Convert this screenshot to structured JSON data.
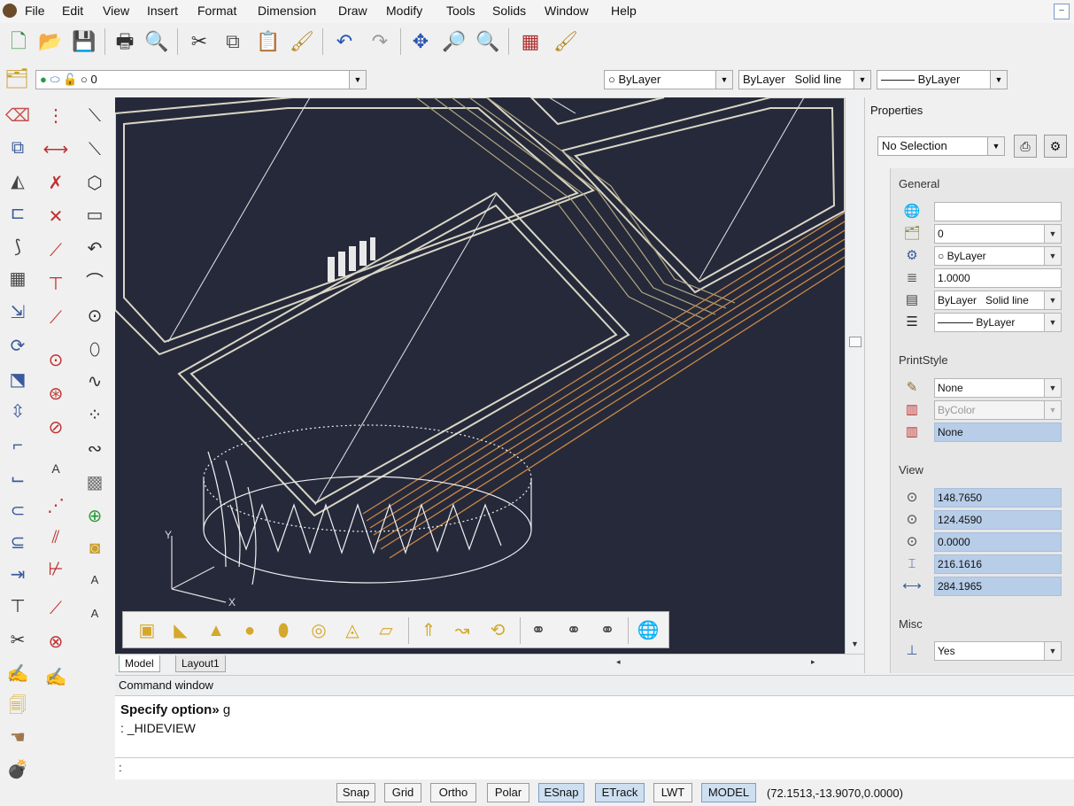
{
  "menu": [
    "File",
    "Edit",
    "View",
    "Insert",
    "Format",
    "Dimension",
    "Draw",
    "Modify",
    "Tools",
    "Solids",
    "Window",
    "Help"
  ],
  "layer_bar": {
    "layer_value": "0",
    "color_value": "ByLayer",
    "linetype_value": "ByLayer",
    "linetype_name": "Solid line",
    "lineweight_value": "ByLayer"
  },
  "viewport": {
    "tabs": [
      "Model",
      "Layout1"
    ],
    "ucs_labels": {
      "x": "X",
      "y": "Y"
    }
  },
  "properties": {
    "title": "Properties",
    "selection": "No Selection",
    "sections": {
      "general": "General",
      "printstyle": "PrintStyle",
      "view": "View",
      "misc": "Misc"
    },
    "general": {
      "color": "",
      "layer": "0",
      "linetype_label": "ByLayer",
      "scale": "1.0000",
      "lineweight_bylayer": "ByLayer",
      "lineweight_name": "Solid line",
      "thickness": "ByLayer"
    },
    "printstyle": {
      "style": "None",
      "color": "ByColor",
      "table": "None"
    },
    "view": [
      "148.7650",
      "124.4590",
      "0.0000",
      "216.1616",
      "284.1965"
    ],
    "misc": {
      "value": "Yes"
    }
  },
  "command": {
    "title": "Command window",
    "line1_bold": "Specify option»",
    "line1_value": " g",
    "line2": ": _HIDEVIEW",
    "prompt": ":"
  },
  "status": {
    "buttons": [
      "Snap",
      "Grid",
      "Ortho",
      "Polar",
      "ESnap",
      "ETrack",
      "LWT",
      "MODEL"
    ],
    "active": [
      "ESnap",
      "ETrack",
      "MODEL"
    ],
    "coordinates": "(72.1513,-13.9070,0.0000)"
  },
  "colors": {
    "viewport_bg": "#26293a",
    "highlight": "#b7cde8",
    "beam_orange": "#c98a45"
  }
}
